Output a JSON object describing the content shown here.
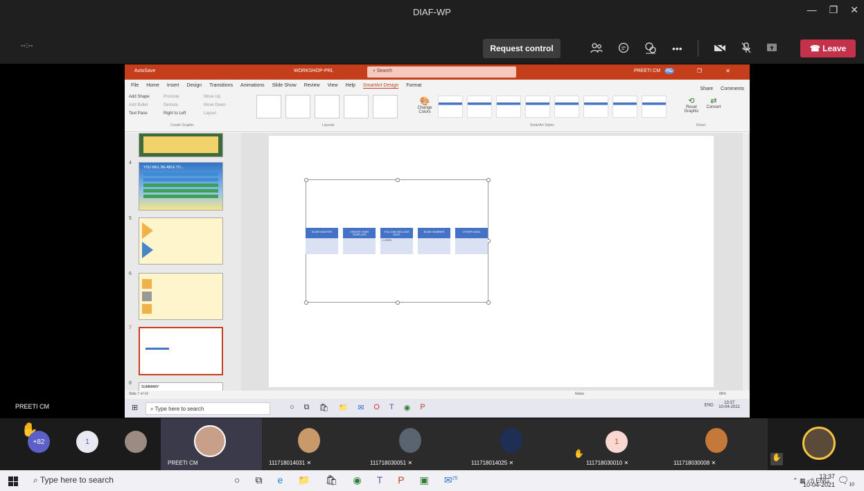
{
  "window": {
    "title": "DIAF-WP",
    "controls": [
      "—",
      "❐",
      "✕"
    ]
  },
  "meeting_bar": {
    "timer": "--:--",
    "request_control": "Request control",
    "leave": "Leave",
    "icons": [
      "people-icon",
      "chat-icon",
      "reactions-icon",
      "more-icon",
      "camera-off-icon",
      "mic-off-icon",
      "share-icon"
    ]
  },
  "shared_screen": {
    "presenter": "PREETI CM",
    "ppt_title": {
      "autosave": "AutoSave",
      "docname": "WORKSHOP-PRL",
      "search": "Search",
      "user": "PREETI CM",
      "user_initials": "PC"
    },
    "ribbon_tabs": [
      "File",
      "Home",
      "Insert",
      "Design",
      "Transitions",
      "Animations",
      "Slide Show",
      "Review",
      "View",
      "Help",
      "SmartArt Design",
      "Format"
    ],
    "active_tab": "SmartArt Design",
    "share": "Share",
    "comments": "Comments",
    "create_graphic": {
      "add_shape": "Add Shape",
      "add_bullet": "Add Bullet",
      "text_pane": "Text Pane",
      "promote": "Promote",
      "demote": "Demote",
      "right_to_left": "Right to Left",
      "move_up": "Move Up",
      "move_down": "Move Down",
      "layout": "Layout",
      "label": "Create Graphic"
    },
    "layouts_label": "Layouts",
    "change_colors": "Change Colors",
    "styles_label": "SmartArt Styles",
    "reset_graphic": "Reset Graphic",
    "convert": "Convert",
    "reset_label": "Reset",
    "slide_numbers": [
      "4",
      "5",
      "6",
      "7",
      "8"
    ],
    "thumb_4_title": "YOU WILL BE ABLE TO...",
    "thumb_8_title": "SUMMARY",
    "slide_status": "Slide 7 of 14",
    "smartart_items": [
      {
        "title": "SLIDE MASTER",
        "sub": ""
      },
      {
        "title": "CREATE OWN TEMPLATE",
        "sub": ""
      },
      {
        "title": "YOU CAN INCLUDE DATE",
        "sub": "• LOGO"
      },
      {
        "title": "SLIDE NUMBER",
        "sub": ""
      },
      {
        "title": "OTHER DATA",
        "sub": ""
      }
    ],
    "notes": "Notes",
    "zoom": "86%",
    "inner_taskbar": {
      "search": "Type here to search",
      "time": "13:37",
      "date": "10-04-2021",
      "lang": "ENG"
    }
  },
  "participants": {
    "raised_count": "+82",
    "count_bubble": "1",
    "tiles": [
      {
        "name": "PREETI CM"
      },
      {
        "name": "111718014031"
      },
      {
        "name": "111718030051"
      },
      {
        "name": "111718014025"
      },
      {
        "name": "111718030010",
        "initial": "1"
      },
      {
        "name": "111718030008"
      }
    ]
  },
  "taskbar": {
    "search": "Type here to search",
    "lang": "ENG",
    "time": "13:37",
    "date": "10-04-2021",
    "badge": "25",
    "notif_count": "10"
  }
}
